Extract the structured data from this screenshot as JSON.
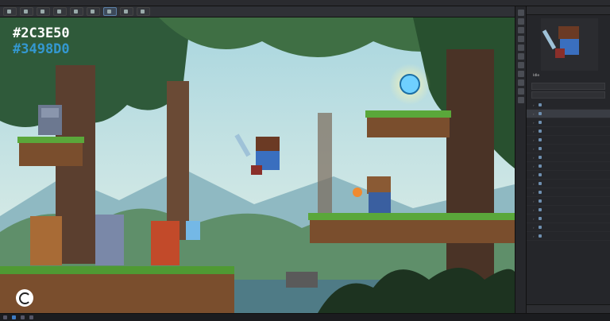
{
  "titlebar": {
    "title": "",
    "menu": [
      "",
      "",
      "",
      ""
    ]
  },
  "toolbar": {
    "tabs": [
      "",
      "",
      "",
      "",
      "",
      "",
      "",
      "",
      ""
    ],
    "active_index": 6
  },
  "overlay": {
    "color_primary": "#2C3E50",
    "color_secondary": "#3498D0"
  },
  "panel": {
    "title": "",
    "preview_label": "Idle",
    "tree_rows": [
      {
        "label": "",
        "selected": false
      },
      {
        "label": "",
        "selected": true
      },
      {
        "label": "",
        "selected": false
      },
      {
        "label": "",
        "selected": false
      },
      {
        "label": "",
        "selected": false
      },
      {
        "label": "",
        "selected": false
      },
      {
        "label": "",
        "selected": false
      },
      {
        "label": "",
        "selected": false
      },
      {
        "label": "",
        "selected": false
      },
      {
        "label": "",
        "selected": false
      },
      {
        "label": "",
        "selected": false
      },
      {
        "label": "",
        "selected": false
      },
      {
        "label": "",
        "selected": false
      },
      {
        "label": "",
        "selected": false
      },
      {
        "label": "",
        "selected": false
      },
      {
        "label": "",
        "selected": false
      }
    ],
    "footer": ""
  },
  "colors": {
    "sky": "#bfe0e8",
    "forest_dark": "#2f5a3a",
    "grass": "#5aa73a",
    "dirt": "#8a5a34",
    "gem": "#6fd0ff",
    "accent": "#3498D0"
  },
  "icons": {
    "logo": "app-logo-icon"
  }
}
